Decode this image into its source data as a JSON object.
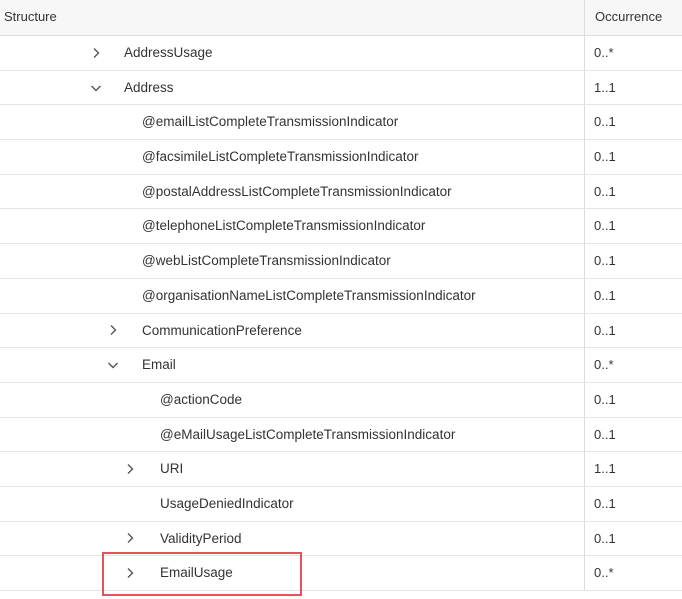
{
  "header": {
    "structure_label": "Structure",
    "occurrence_label": "Occurrence"
  },
  "rows": [
    {
      "label": "AddressUsage",
      "occurrence": "0..*",
      "toggle": "chevron-right-icon"
    },
    {
      "label": "Address",
      "occurrence": "1..1",
      "toggle": "chevron-down-icon"
    },
    {
      "label": "@emailListCompleteTransmissionIndicator",
      "occurrence": "0..1",
      "toggle": ""
    },
    {
      "label": "@facsimileListCompleteTransmissionIndicator",
      "occurrence": "0..1",
      "toggle": ""
    },
    {
      "label": "@postalAddressListCompleteTransmissionIndicator",
      "occurrence": "0..1",
      "toggle": ""
    },
    {
      "label": "@telephoneListCompleteTransmissionIndicator",
      "occurrence": "0..1",
      "toggle": ""
    },
    {
      "label": "@webListCompleteTransmissionIndicator",
      "occurrence": "0..1",
      "toggle": ""
    },
    {
      "label": "@organisationNameListCompleteTransmissionIndicator",
      "occurrence": "0..1",
      "toggle": ""
    },
    {
      "label": "CommunicationPreference",
      "occurrence": "0..1",
      "toggle": "chevron-right-icon"
    },
    {
      "label": "Email",
      "occurrence": "0..*",
      "toggle": "chevron-down-icon"
    },
    {
      "label": "@actionCode",
      "occurrence": "0..1",
      "toggle": ""
    },
    {
      "label": "@eMailUsageListCompleteTransmissionIndicator",
      "occurrence": "0..1",
      "toggle": ""
    },
    {
      "label": "URI",
      "occurrence": "1..1",
      "toggle": "chevron-right-icon"
    },
    {
      "label": "UsageDeniedIndicator",
      "occurrence": "0..1",
      "toggle": ""
    },
    {
      "label": "ValidityPeriod",
      "occurrence": "0..1",
      "toggle": "chevron-right-icon"
    },
    {
      "label": "EmailUsage",
      "occurrence": "0..*",
      "toggle": "chevron-right-icon"
    }
  ],
  "colors": {
    "highlight": "#e0555a",
    "chevron": "#555555"
  }
}
